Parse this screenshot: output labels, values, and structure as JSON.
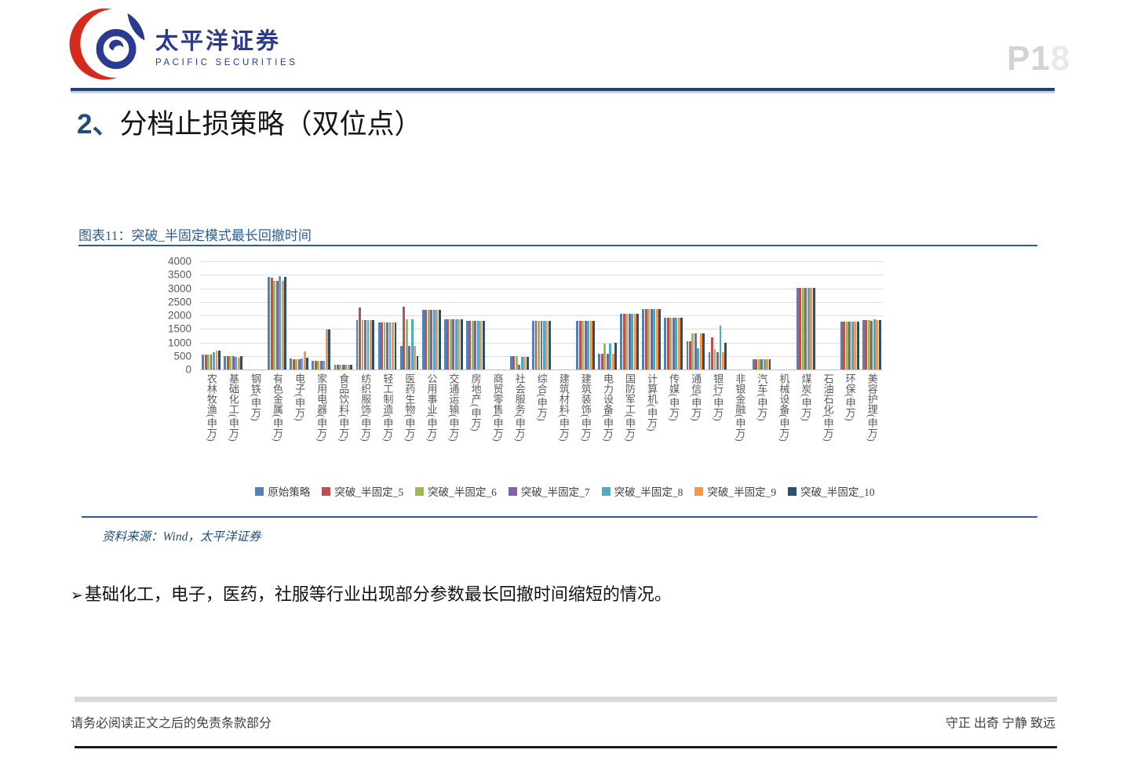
{
  "header": {
    "logo_cn": "太平洋证券",
    "logo_en": "PACIFIC SECURITIES",
    "page_number_prefix": "P1",
    "page_number_suffix": "8"
  },
  "title": {
    "number": "2、",
    "text": "分档止损策略（双位点）"
  },
  "figure": {
    "caption": "图表11：突破_半固定模式最长回撤时间",
    "source": "资料来源：Wind，太平洋证券"
  },
  "chart_data": {
    "type": "bar",
    "title": "突破_半固定模式最长回撤时间",
    "ylim": [
      0,
      4000
    ],
    "ytick_step": 500,
    "yticks": [
      0,
      500,
      1000,
      1500,
      2000,
      2500,
      3000,
      3500,
      4000
    ],
    "grid": true,
    "legend_position": "bottom",
    "categories": [
      "农林牧渔(申万)",
      "基础化工(申万)",
      "钢铁(申万)",
      "有色金属(申万)",
      "电子(申万)",
      "家用电器(申万)",
      "食品饮料(申万)",
      "纺织服饰(申万)",
      "轻工制造(申万)",
      "医药生物(申万)",
      "公用事业(申万)",
      "交通运输(申万)",
      "房地产(申万)",
      "商贸零售(申万)",
      "社会服务(申万)",
      "综合(申万)",
      "建筑材料(申万)",
      "建筑装饰(申万)",
      "电力设备(申万)",
      "国防军工(申万)",
      "计算机(申万)",
      "传媒(申万)",
      "通信(申万)",
      "银行(申万)",
      "非银金融(申万)",
      "汽车(申万)",
      "机械设备(申万)",
      "煤炭(申万)",
      "石油石化(申万)",
      "环保(申万)",
      "美容护理(申万)"
    ],
    "series": [
      {
        "name": "原始策略",
        "color": "#4F81BD",
        "values": [
          560,
          500,
          0,
          3420,
          420,
          330,
          180,
          1840,
          1750,
          880,
          2200,
          1850,
          1790,
          0,
          480,
          1790,
          0,
          1790,
          570,
          2060,
          2230,
          1920,
          1030,
          640,
          0,
          380,
          0,
          3020,
          0,
          1780,
          1820
        ]
      },
      {
        "name": "突破_半固定_5",
        "color": "#C0504D",
        "values": [
          560,
          500,
          0,
          3380,
          370,
          330,
          180,
          2290,
          1750,
          2330,
          2200,
          1850,
          1790,
          0,
          480,
          1790,
          0,
          1790,
          570,
          2060,
          2230,
          1920,
          1030,
          1180,
          0,
          380,
          0,
          3020,
          0,
          1780,
          1840
        ]
      },
      {
        "name": "突破_半固定_6",
        "color": "#9BBB59",
        "values": [
          560,
          500,
          0,
          3290,
          370,
          330,
          180,
          1830,
          1750,
          1870,
          2200,
          1850,
          1790,
          0,
          500,
          1790,
          0,
          1790,
          950,
          2060,
          2230,
          1920,
          1340,
          750,
          0,
          380,
          0,
          3020,
          0,
          1780,
          1820
        ]
      },
      {
        "name": "突破_半固定_7",
        "color": "#8064A2",
        "values": [
          560,
          490,
          0,
          3290,
          390,
          330,
          180,
          1830,
          1750,
          860,
          2200,
          1850,
          1790,
          0,
          160,
          1790,
          0,
          1790,
          570,
          2060,
          2230,
          1920,
          1320,
          630,
          0,
          380,
          0,
          3020,
          0,
          1780,
          1790
        ]
      },
      {
        "name": "突破_半固定_8",
        "color": "#4BACC6",
        "values": [
          650,
          470,
          0,
          3440,
          420,
          330,
          180,
          1830,
          1750,
          1870,
          2200,
          1850,
          1790,
          0,
          460,
          1790,
          0,
          1790,
          950,
          2060,
          2230,
          1920,
          780,
          1610,
          0,
          380,
          0,
          3020,
          0,
          1780,
          1850
        ]
      },
      {
        "name": "突破_半固定_9",
        "color": "#F79646",
        "values": [
          700,
          430,
          0,
          3290,
          680,
          1490,
          180,
          1830,
          1750,
          880,
          2200,
          1850,
          1790,
          0,
          460,
          1790,
          0,
          1790,
          570,
          2060,
          2230,
          1920,
          1320,
          640,
          0,
          380,
          0,
          3020,
          0,
          1780,
          1840
        ]
      },
      {
        "name": "突破_半固定_10",
        "color": "#2C4D75",
        "values": [
          700,
          490,
          0,
          3430,
          430,
          1490,
          180,
          1840,
          1750,
          480,
          2200,
          1850,
          1790,
          0,
          460,
          1790,
          0,
          1790,
          980,
          2060,
          2230,
          1920,
          1340,
          1000,
          0,
          380,
          0,
          3020,
          0,
          1780,
          1840
        ]
      }
    ]
  },
  "bullet": {
    "marker": "➢",
    "text": "基础化工，电子，医药，社服等行业出现部分参数最长回撤时间缩短的情况。"
  },
  "footer": {
    "left": "请务必阅读正文之后的免责条款部分",
    "right": "守正 出奇 宁静 致远"
  }
}
